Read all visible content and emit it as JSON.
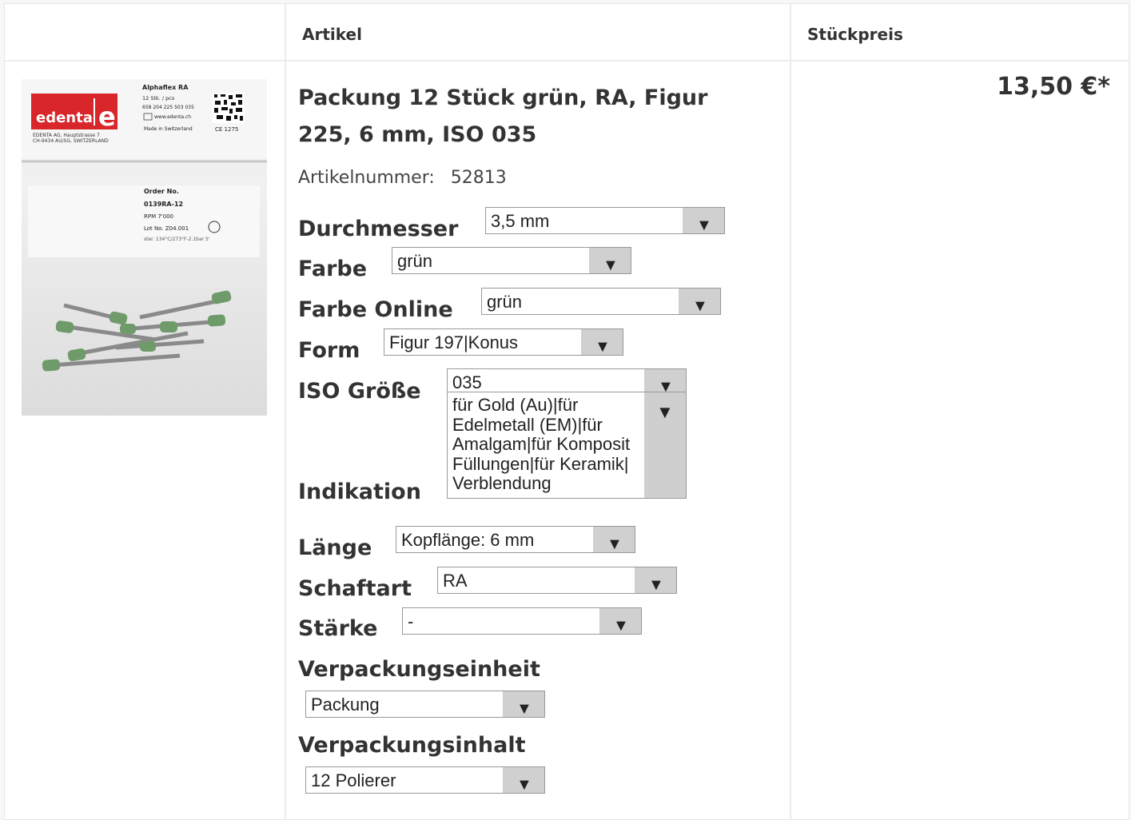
{
  "header": {
    "col_article": "Artikel",
    "col_unit_price": "Stückpreis"
  },
  "product": {
    "title": "Packung 12 Stück grün, RA, Figur 225, 6 mm, ISO 035",
    "article_number_label": "Artikelnummer:",
    "article_number": "52813",
    "price": "13,50 €*",
    "image": {
      "brand": "edenta",
      "brand_letter": "e",
      "product_name": "Alphaflex RA",
      "qty": "12 Stk. / pcs",
      "code": "658 204 225 503 035",
      "website": "www.edenta.ch",
      "made_in": "Made in Switzerland",
      "ce": "CE 1275",
      "address1": "EDENTA AG, Hauptstrasse 7",
      "address2": "CH-9434 AU/SG, SWITZERLAND",
      "order_label": "Order No.",
      "order_no": "0139RA-12",
      "rpm": "RPM 7'000",
      "lot": "Lot No. Z04.001",
      "ster": "ster. 134°C/273°F-2.1bar 5'"
    }
  },
  "options": {
    "durchmesser": {
      "label": "Durchmesser",
      "value": "3,5 mm"
    },
    "farbe": {
      "label": "Farbe",
      "value": "grün"
    },
    "farbe_online": {
      "label": "Farbe Online",
      "value": "grün"
    },
    "form": {
      "label": "Form",
      "value": "Figur 197|Konus"
    },
    "iso": {
      "label": "ISO Größe",
      "value": "035"
    },
    "indikation": {
      "label": "Indikation",
      "value": "für Gold (Au)|für Edelmetall (EM)|für Amalgam|für Komposit Füllungen|für Keramik| Verblendung"
    },
    "laenge": {
      "label": "Länge",
      "value": "Kopflänge: 6 mm"
    },
    "schaftart": {
      "label": "Schaftart",
      "value": "RA"
    },
    "staerke": {
      "label": "Stärke",
      "value": "-"
    },
    "verpackungseinheit": {
      "label": "Verpackungseinheit",
      "value": "Packung"
    },
    "verpackungsinhalt": {
      "label": "Verpackungsinhalt",
      "value": "12 Polierer"
    }
  },
  "icons": {
    "dropdown": "▼"
  },
  "colors": {
    "brand_red": "#d9262b",
    "tip_green": "#6f9a6a"
  }
}
